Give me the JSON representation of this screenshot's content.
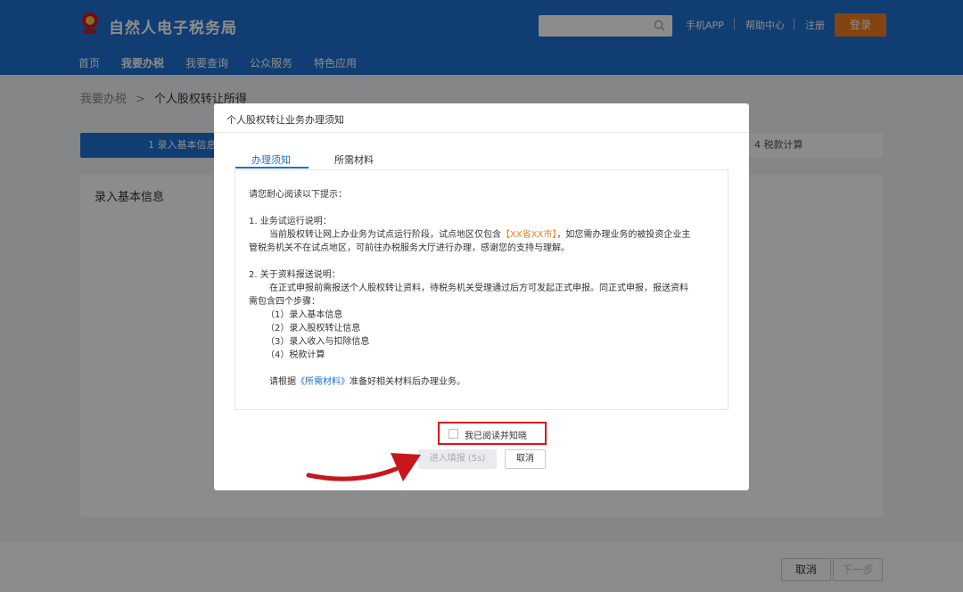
{
  "header": {
    "site_title": "自然人电子税务局",
    "search_placeholder": "",
    "links": [
      "手机APP",
      "帮助中心",
      "注册"
    ],
    "login_label": "登录",
    "nav": [
      "首页",
      "我要办税",
      "我要查询",
      "公众服务",
      "特色应用"
    ],
    "active_nav": "我要办税"
  },
  "breadcrumb": {
    "parent": "我要办税",
    "separator": ">",
    "current": "个人股权转让所得"
  },
  "steps": {
    "step1": "1  录入基本信息",
    "step4": "4  税款计算"
  },
  "panel": {
    "title": "录入基本信息"
  },
  "footer": {
    "cancel_label": "取消",
    "next_label": "下一步"
  },
  "modal": {
    "title": "个人股权转让业务办理须知",
    "tabs": [
      "办理须知",
      "所需材料"
    ],
    "intro": "请您耐心阅读以下提示：",
    "section1_title": "1. 业务试运行说明：",
    "section1_line1_pre": "当前股权转让网上办业务为试点运行阶段，试点地区仅包含",
    "section1_line1_hl": "【XX省XX市】",
    "section1_line1_post": "，如您需办理业务的被投资企业主",
    "section1_line2": "管税务机关不在试点地区，可前往办税服务大厅进行办理，感谢您的支持与理解。",
    "section2_title": "2. 关于资料报送说明：",
    "section2_line1": "在正式申报前需报送个人股权转让资料，待税务机关受理通过后方可发起正式申报。同正式申报，报送资料",
    "section2_line2": "需包含四个步骤：",
    "steps_list": [
      "（1）录入基本信息",
      "（2）录入股权转让信息",
      "（3）录入收入与扣除信息",
      "（4）税款计算"
    ],
    "closing_pre": "请根据",
    "closing_link": "《所需材料》",
    "closing_post": "准备好相关材料后办理业务。",
    "checkbox_label": "我已阅读并知晓",
    "enter_label": "进入填报 (5s)",
    "cancel_label": "取消"
  },
  "colors": {
    "primary": "#1e6fd0",
    "accent_orange": "#f07d1c",
    "highlight_red": "#d9141b"
  }
}
